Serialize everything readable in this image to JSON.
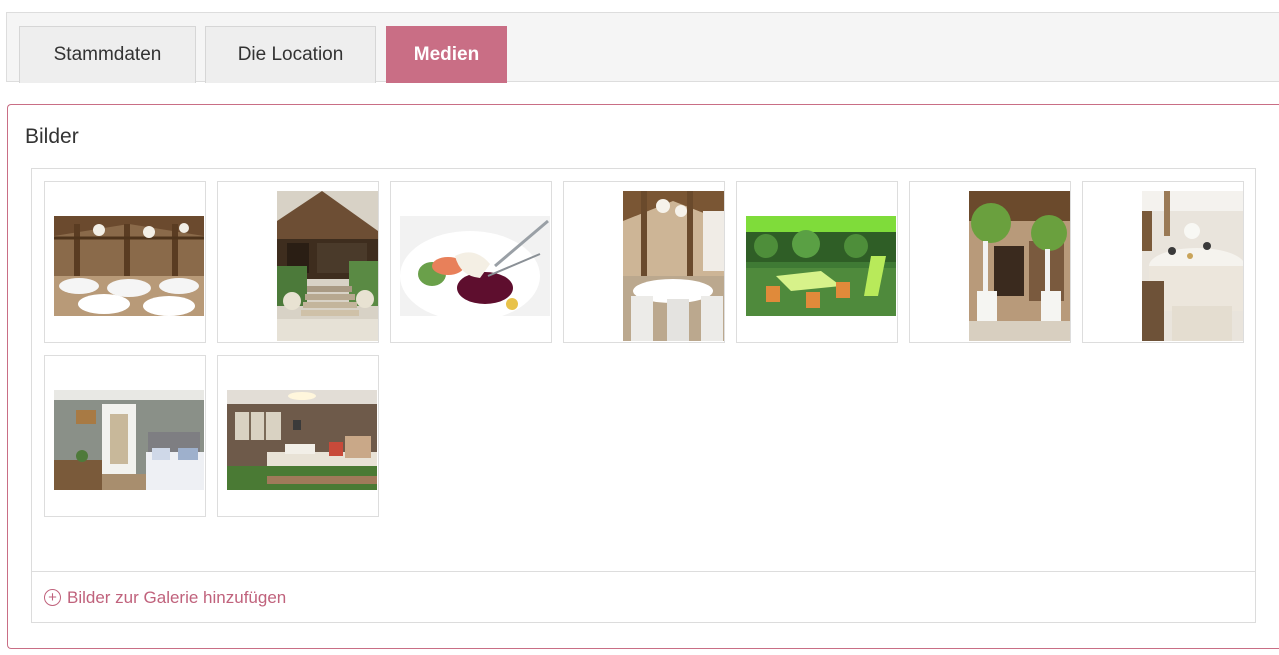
{
  "tabs": [
    {
      "label": "Stammdaten",
      "active": false
    },
    {
      "label": "Die Location",
      "active": false
    },
    {
      "label": "Medien",
      "active": true
    }
  ],
  "panel": {
    "title": "Bilder",
    "add_images_label": "Bilder zur Galerie hinzufügen",
    "add_icon": "plus-circle-icon"
  },
  "colors": {
    "accent": "#c96e85",
    "link": "#c0627c",
    "border": "#dddddd"
  },
  "gallery": {
    "images": [
      {
        "name": "barn-hall-interior"
      },
      {
        "name": "barn-entrance-stairs"
      },
      {
        "name": "plated-dish"
      },
      {
        "name": "banquet-hall-portrait"
      },
      {
        "name": "garden-terrace-tables"
      },
      {
        "name": "entrance-topiary-trees"
      },
      {
        "name": "round-table-setting"
      },
      {
        "name": "hotel-room-1"
      },
      {
        "name": "hotel-room-2"
      }
    ]
  }
}
